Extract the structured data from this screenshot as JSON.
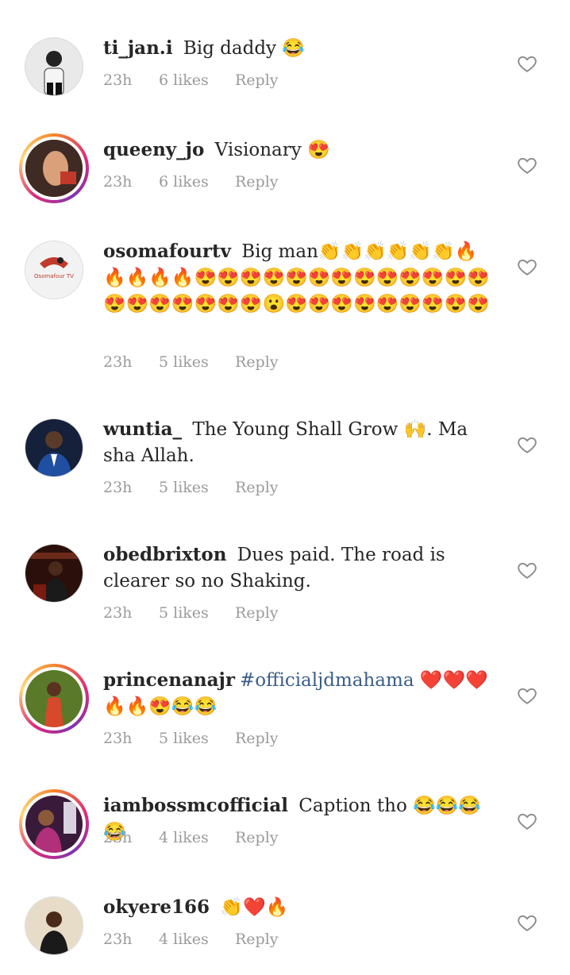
{
  "comments": [
    {
      "username": "ti_jan.i",
      "text": " Big daddy 😂",
      "time": "23h",
      "likes": "6 likes",
      "reply": "Reply",
      "has_story_ring": false,
      "avatar_color": "#cfcfcf"
    },
    {
      "username": "queeny_jo",
      "text": " Visionary 😍",
      "time": "23h",
      "likes": "6 likes",
      "reply": "Reply",
      "has_story_ring": true,
      "avatar_color": "#7a2a1f"
    },
    {
      "username": "osomafourtv",
      "text": " Big man👏👏👏👏👏👏🔥🔥🔥🔥🔥😍😍😍😍😍😍😍😍😍😍😍😍😍😍😍😍😍😍😍😍😮😍😍😍😍😍😍😍😍😍",
      "time": "23h",
      "likes": "5 likes",
      "reply": "Reply",
      "has_story_ring": false,
      "avatar_color": "#e8e8e8",
      "avatar_label": "Osomafour TV"
    },
    {
      "username": "wuntia_",
      "text": " The Young Shall Grow 🙌. Ma sha Allah.",
      "time": "23h",
      "likes": "5 likes",
      "reply": "Reply",
      "has_story_ring": false,
      "avatar_color": "#1e2b4a"
    },
    {
      "username": "obedbrixton",
      "text": " Dues paid. The road is clearer so no Shaking.",
      "time": "23h",
      "likes": "5 likes",
      "reply": "Reply",
      "has_story_ring": false,
      "avatar_color": "#3a1a14"
    },
    {
      "username": "princenanajr",
      "hashtag": "#officialjdmahama",
      "text": " ❤️❤️❤️🔥🔥😍😂😂",
      "time": "23h",
      "likes": "5 likes",
      "reply": "Reply",
      "has_story_ring": true,
      "avatar_color": "#c0502a"
    },
    {
      "username": "iambossmcofficial",
      "text": " Caption tho 😂😂😂😂",
      "time": "23h",
      "likes": "4 likes",
      "reply": "Reply",
      "has_story_ring": true,
      "avatar_color": "#6a2f5a"
    },
    {
      "username": "okyere166",
      "text": " 👏❤️🔥",
      "time": "23h",
      "likes": "4 likes",
      "reply": "Reply",
      "has_story_ring": false,
      "avatar_color": "#b9a27a"
    }
  ],
  "icons": {
    "heart": "heart-outline-icon"
  }
}
